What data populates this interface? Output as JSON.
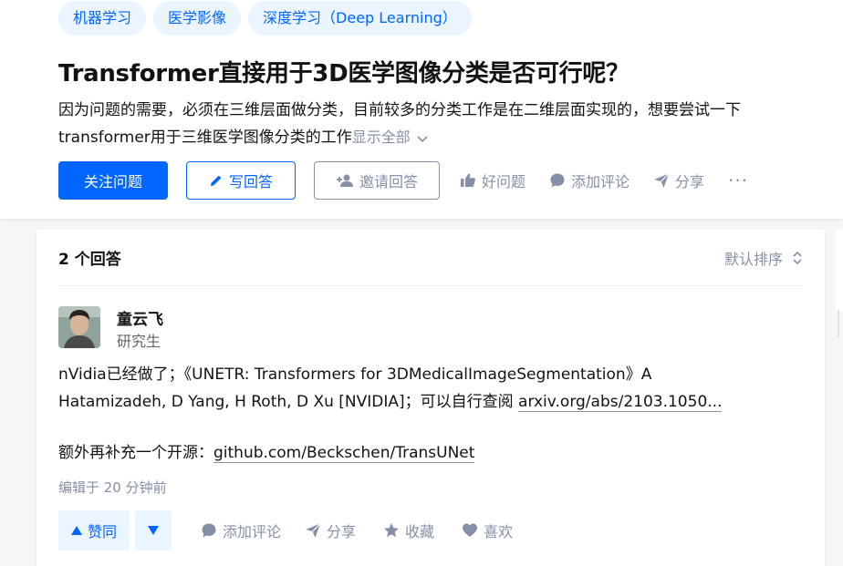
{
  "question": {
    "topics": [
      "机器学习",
      "医学影像",
      "深度学习（Deep Learning）"
    ],
    "title": "Transformer直接用于3D医学图像分类是否可行呢？",
    "detail_line1": "因为问题的需要，必须在三维层面做分类，目前较多的分类工作是在二维层面实现的，想要尝试一下",
    "detail_line2": "transformer用于三维医学图像分类的工作",
    "show_all": "显示全部",
    "actions": {
      "follow": "关注问题",
      "write_answer": "写回答",
      "invite": "邀请回答",
      "good_question": "好问题",
      "add_comment": "添加评论",
      "share": "分享",
      "more": "···"
    }
  },
  "answers": {
    "count_label": "2 个回答",
    "sort_label": "默认排序",
    "items": [
      {
        "author_name": "童云飞",
        "author_title": "研究生",
        "body_line1": "nVidia已经做了；《UNETR: Transformers for 3DMedicalImageSegmentation》A",
        "body_line2_prefix": "Hatamizadeh, D Yang, H Roth, D Xu [NVIDIA]；可以自行查阅 ",
        "link1": "arxiv.org/abs/2103.1050...",
        "body_line3_prefix": "额外再补充一个开源：",
        "link2": "github.com/Beckschen/TransUNet",
        "edited": "编辑于 20 分钟前",
        "vote_up": "赞同",
        "add_comment": "添加评论",
        "share": "分享",
        "favorite": "收藏",
        "like": "喜欢"
      }
    ]
  },
  "colors": {
    "brand_blue": "#0066ff",
    "tag_bg": "#ebf5ff",
    "gray_text": "#8590a6"
  }
}
